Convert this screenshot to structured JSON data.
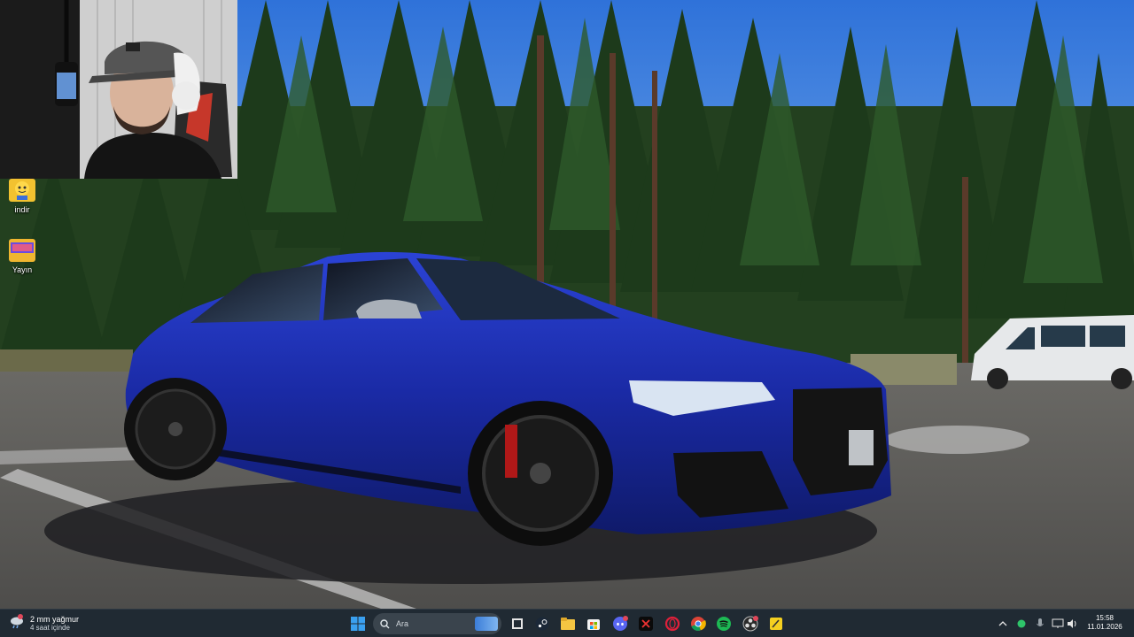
{
  "desktop": {
    "icons": [
      {
        "label": "indir",
        "icon": "emoji-folder-icon"
      },
      {
        "label": "Yayın",
        "icon": "image-folder-icon"
      }
    ]
  },
  "webcam": {
    "description_icon": "webcam-feed-icon"
  },
  "taskbar": {
    "weather": {
      "line1": "2 mm yağmur",
      "line2": "4 saat içinde",
      "icon": "rain-cloud-icon"
    },
    "search_placeholder": "Ara",
    "pinned_apps": [
      "windows-start-icon",
      "task-view-icon",
      "steam-icon",
      "file-explorer-icon",
      "microsoft-store-icon",
      "discord-icon",
      "capcut-icon",
      "opera-gx-icon",
      "chrome-icon",
      "spotify-icon",
      "obs-icon",
      "notes-app-icon"
    ],
    "clock": {
      "time": "15:58",
      "date": "11.01.2026"
    }
  },
  "colors": {
    "taskbar_bg": "#202a33",
    "car_blue": "#1c2fb0",
    "sky": "#3f7fe0"
  }
}
